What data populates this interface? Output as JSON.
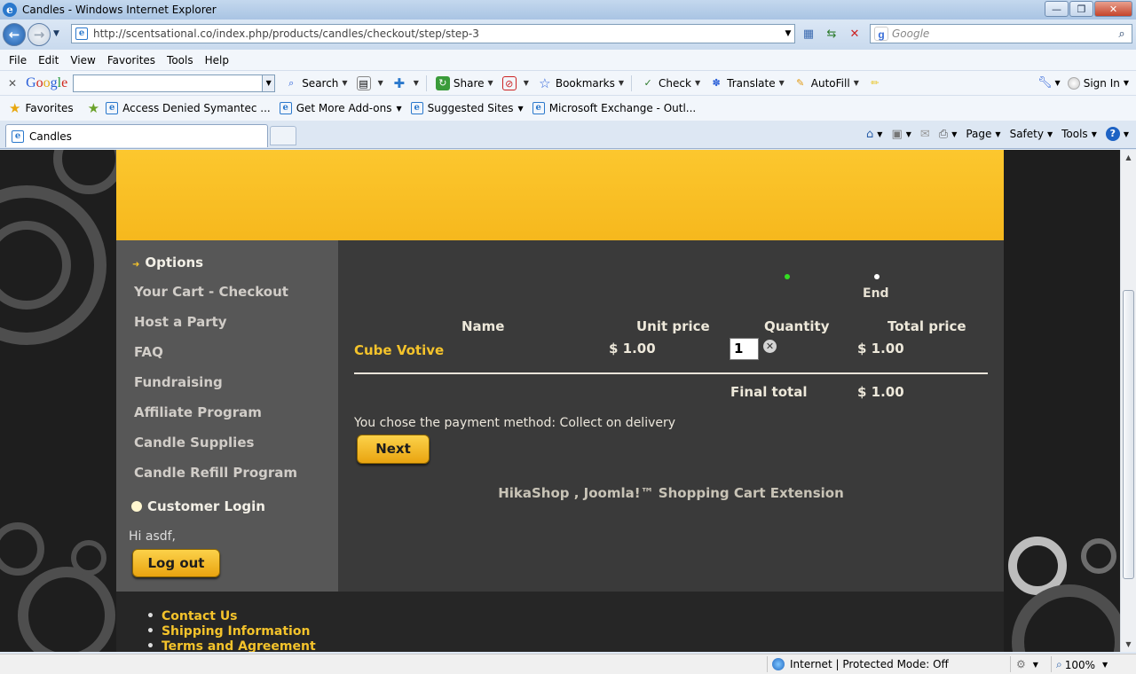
{
  "window": {
    "title": "Candles - Windows Internet Explorer"
  },
  "address": {
    "url": "http://scentsational.co/index.php/products/candles/checkout/step/step-3"
  },
  "search": {
    "placeholder": "Google"
  },
  "menu": [
    "File",
    "Edit",
    "View",
    "Favorites",
    "Tools",
    "Help"
  ],
  "google_toolbar": {
    "logo": "Google",
    "tools": [
      "Search",
      "Share",
      "Bookmarks",
      "Check",
      "Translate",
      "AutoFill"
    ],
    "sign_in": "Sign In"
  },
  "favorites_bar": {
    "favorites_label": "Favorites",
    "items": [
      "Access Denied  Symantec ...",
      "Get More Add-ons",
      "Suggested Sites",
      "Microsoft Exchange - Outl..."
    ]
  },
  "tab": {
    "label": "Candles"
  },
  "command_bar": {
    "page": "Page",
    "safety": "Safety",
    "tools": "Tools"
  },
  "sidebar": {
    "items": [
      "Options",
      "Your Cart - Checkout",
      "Host a Party",
      "FAQ",
      "Fundraising",
      "Affiliate Program",
      "Candle Supplies",
      "Candle Refill Program"
    ],
    "customer_login": "Customer Login",
    "greeting": "Hi asdf,",
    "logout_label": "Log out"
  },
  "checkout": {
    "step_end_label": "End",
    "columns": {
      "name": "Name",
      "unit_price": "Unit price",
      "quantity": "Quantity",
      "total_price": "Total price"
    },
    "item": {
      "name": "Cube Votive",
      "unit_price": "$ 1.00",
      "quantity": "1",
      "total_price": "$ 1.00"
    },
    "final_total_label": "Final total",
    "final_total": "$ 1.00",
    "payment_text": "You chose the payment method: Collect on delivery",
    "next_label": "Next",
    "credit": "HikaShop , Joomla!™ Shopping Cart Extension",
    "colors": {
      "active_step": "#33dd22",
      "accent": "#f4c32b"
    }
  },
  "footer": {
    "links": [
      "Contact Us",
      "Shipping Information",
      "Terms and Agreement"
    ]
  },
  "status": {
    "zone": "Internet | Protected Mode: Off",
    "zoom": "100%"
  }
}
